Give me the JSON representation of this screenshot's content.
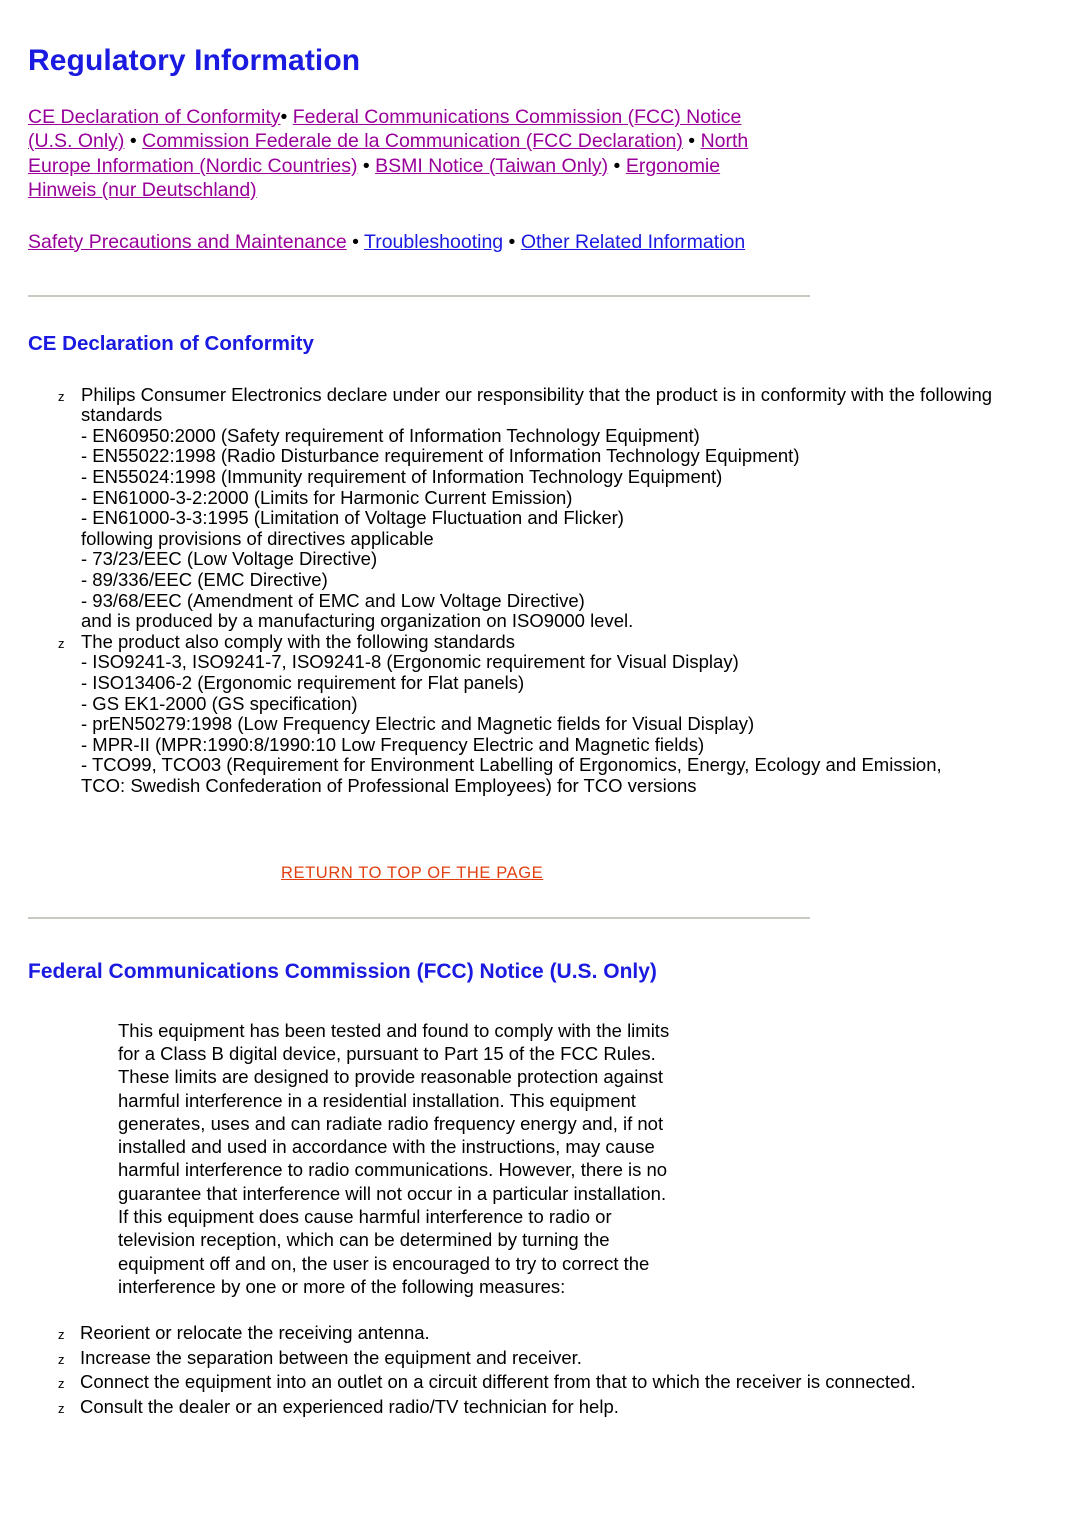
{
  "colors": {
    "heading_blue": "#1a1ae0",
    "visited_link_purple": "#990099",
    "unvisited_link_blue": "#1a1ae0",
    "return_link_orange": "#e04010",
    "divider_gray": "#c9c9c2",
    "body_text": "#000000"
  },
  "page": {
    "title": "Regulatory Information"
  },
  "nav": {
    "separator": " • ",
    "separator_tight": "• ",
    "group1": [
      {
        "label": "CE Declaration of Conformity",
        "state": "visited"
      },
      {
        "label": "Federal Communications Commission (FCC) Notice (U.S. Only)",
        "state": "visited"
      },
      {
        "label": "Commission Federale de la Communication (FCC Declaration)",
        "state": "visited"
      },
      {
        "label": "North Europe Information (Nordic Countries)",
        "state": "visited"
      },
      {
        "label": "BSMI Notice (Taiwan Only)",
        "state": "visited"
      },
      {
        "label": "Ergonomie Hinweis (nur Deutschland)",
        "state": "visited"
      }
    ],
    "group2": [
      {
        "label": "Safety Precautions and Maintenance",
        "state": "visited"
      },
      {
        "label": "Troubleshooting",
        "state": "unvisited"
      },
      {
        "label": "Other Related Information",
        "state": "unvisited"
      }
    ]
  },
  "sections": {
    "ce": {
      "heading": "CE Declaration of Conformity",
      "bullets": [
        {
          "marker": "z",
          "lead": "Philips Consumer Electronics declare under our responsibility that the product is in conformity with the following standards",
          "lines": [
            "- EN60950:2000 (Safety requirement of Information Technology Equipment)",
            "- EN55022:1998 (Radio Disturbance requirement of Information Technology Equipment)",
            "- EN55024:1998 (Immunity requirement of Information Technology Equipment)",
            "- EN61000-3-2:2000 (Limits for Harmonic Current Emission)",
            "- EN61000-3-3:1995 (Limitation of Voltage Fluctuation and Flicker)",
            "following provisions of directives applicable",
            "- 73/23/EEC (Low Voltage Directive)",
            "- 89/336/EEC (EMC Directive)",
            "- 93/68/EEC (Amendment of EMC and Low Voltage Directive)",
            "and is produced by a manufacturing organization on ISO9000 level."
          ]
        },
        {
          "marker": "z",
          "lead": "The product also comply with the following standards",
          "lines": [
            "- ISO9241-3, ISO9241-7, ISO9241-8 (Ergonomic requirement for Visual Display)",
            "- ISO13406-2 (Ergonomic requirement for Flat panels)",
            "- GS EK1-2000 (GS specification)",
            "- prEN50279:1998 (Low Frequency Electric and Magnetic fields for Visual Display)",
            "- MPR-II (MPR:1990:8/1990:10 Low Frequency Electric and Magnetic fields)",
            "- TCO99, TCO03 (Requirement for Environment Labelling of Ergonomics, Energy, Ecology and Emission,",
            "TCO: Swedish Confederation of Professional Employees) for TCO versions"
          ]
        }
      ],
      "return_link": "RETURN TO TOP OF THE PAGE"
    },
    "fcc": {
      "heading": "Federal Communications Commission (FCC) Notice (U.S. Only)",
      "paragraph": "This equipment has been tested and found to comply with the limits for a Class B digital device, pursuant to Part 15 of the FCC Rules. These limits are designed to provide reasonable protection against harmful interference in a residential installation. This equipment generates, uses and can radiate radio frequency energy and, if not installed and used in accordance with the instructions, may cause harmful interference to radio communications. However, there is no guarantee that interference will not occur in a particular installation. If this equipment does cause harmful interference to radio or television reception, which can be determined by turning the equipment off and on, the user is encouraged to try to correct the interference by one or more of the following measures:",
      "measures": [
        {
          "marker": "z",
          "text": "Reorient or relocate the receiving antenna."
        },
        {
          "marker": "z",
          "text": "Increase the separation between the equipment and receiver."
        },
        {
          "marker": "z",
          "text": "Connect the equipment into an outlet on a circuit different from that to which the receiver is connected."
        },
        {
          "marker": "z",
          "text": "Consult the dealer or an experienced radio/TV technician for help."
        }
      ]
    }
  }
}
